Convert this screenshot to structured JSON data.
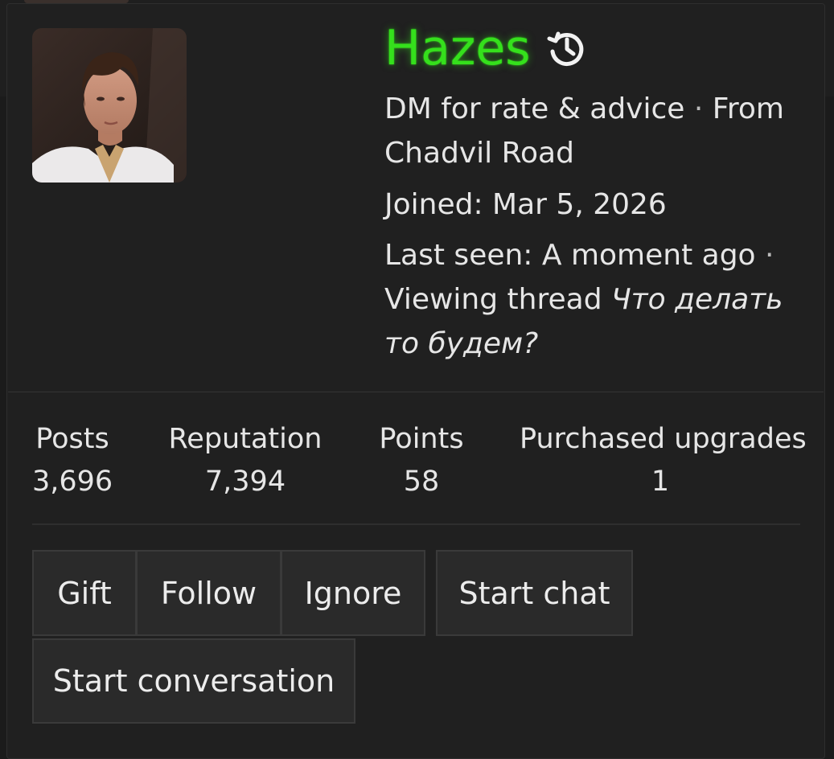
{
  "profile": {
    "username": "Hazes",
    "username_color": "#35e01c",
    "history_icon": "history-icon",
    "title_line": "DM for rate & advice",
    "separator": "·",
    "location_prefix": "From",
    "location": "Chadvil Road",
    "joined_label": "Joined:",
    "joined_value": "Mar 5, 2026",
    "last_seen_label": "Last seen:",
    "last_seen_value": "A moment ago",
    "viewing_prefix": "Viewing thread",
    "viewing_thread": "Что делать то будем?"
  },
  "stats": [
    {
      "label": "Posts",
      "value": "3,696"
    },
    {
      "label": "Reputation",
      "value": "7,394"
    },
    {
      "label": "Points",
      "value": "58"
    },
    {
      "label": "Purchased upgrades",
      "value": "1"
    }
  ],
  "actions": {
    "gift": "Gift",
    "follow": "Follow",
    "ignore": "Ignore",
    "start_chat": "Start chat",
    "start_conversation": "Start conversation"
  }
}
